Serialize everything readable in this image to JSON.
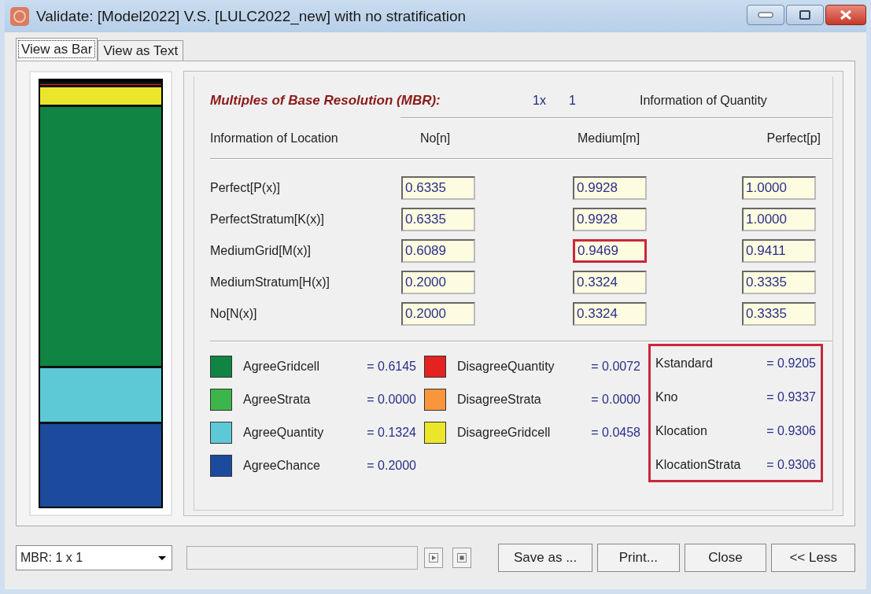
{
  "window": {
    "title": "Validate: [Model2022]  V.S.  [LULC2022_new] with no stratification"
  },
  "tabs": [
    {
      "label": "View as Bar",
      "selected": true
    },
    {
      "label": "View as Text",
      "selected": false
    }
  ],
  "mbr": {
    "title": "Multiples of Base Resolution (MBR):",
    "x_label": "1x",
    "y_value": "1",
    "quantity_label": "Information of Quantity"
  },
  "table": {
    "columns": [
      "Information of Location",
      "No[n]",
      "Medium[m]",
      "Perfect[p]"
    ],
    "rows": [
      {
        "cells": [
          {
            "kind": "label",
            "text": "Perfect[P(x)]"
          },
          {
            "kind": "field",
            "value": "0.6335",
            "highlighted": false
          },
          {
            "kind": "field",
            "value": "0.9928",
            "highlighted": false
          },
          {
            "kind": "field",
            "value": "1.0000",
            "highlighted": false
          }
        ]
      },
      {
        "cells": [
          {
            "kind": "label",
            "text": "PerfectStratum[K(x)]"
          },
          {
            "kind": "field",
            "value": "0.6335",
            "highlighted": false
          },
          {
            "kind": "field",
            "value": "0.9928",
            "highlighted": false
          },
          {
            "kind": "field",
            "value": "1.0000",
            "highlighted": false
          }
        ]
      },
      {
        "cells": [
          {
            "kind": "label",
            "text": "MediumGrid[M(x)]"
          },
          {
            "kind": "field",
            "value": "0.6089",
            "highlighted": false
          },
          {
            "kind": "field",
            "value": "0.9469",
            "highlighted": true
          },
          {
            "kind": "field",
            "value": "0.9411",
            "highlighted": false
          }
        ]
      },
      {
        "cells": [
          {
            "kind": "label",
            "text": "MediumStratum[H(x)]"
          },
          {
            "kind": "field",
            "value": "0.2000",
            "highlighted": false
          },
          {
            "kind": "field",
            "value": "0.3324",
            "highlighted": false
          },
          {
            "kind": "field",
            "value": "0.3335",
            "highlighted": false
          }
        ]
      },
      {
        "cells": [
          {
            "kind": "label",
            "text": "No[N(x)]"
          },
          {
            "kind": "field",
            "value": "0.2000",
            "highlighted": false
          },
          {
            "kind": "field",
            "value": "0.3324",
            "highlighted": false
          },
          {
            "kind": "field",
            "value": "0.3335",
            "highlighted": false
          }
        ]
      }
    ]
  },
  "legend": [
    [
      {
        "label": "AgreeGridcell",
        "value": "= 0.6145",
        "color": "#108443"
      },
      {
        "label": "AgreeStrata",
        "value": "= 0.0000",
        "color": "#3cb54a"
      },
      {
        "label": "AgreeQuantity",
        "value": "= 0.1324",
        "color": "#5ec9d6"
      },
      {
        "label": "AgreeChance",
        "value": "= 0.2000",
        "color": "#1c4b9e"
      }
    ],
    [
      {
        "label": "DisagreeQuantity",
        "value": "= 0.0072",
        "color": "#e52222"
      },
      {
        "label": "DisagreeStrata",
        "value": "= 0.0000",
        "color": "#f7963a"
      },
      {
        "label": "DisagreeGridcell",
        "value": "= 0.0458",
        "color": "#ece62a"
      }
    ]
  ],
  "kappa": {
    "highlighted": true,
    "items": [
      {
        "label": "Kstandard",
        "value": "= 0.9205"
      },
      {
        "label": "Kno",
        "value": "= 0.9337"
      },
      {
        "label": "Klocation",
        "value": "= 0.9306"
      },
      {
        "label": "KlocationStrata",
        "value": "= 0.9306"
      }
    ]
  },
  "bottom": {
    "mbr_select": "MBR: 1 x 1",
    "buttons": [
      "Save as ...",
      "Print...",
      "Close",
      "<< Less"
    ]
  }
}
